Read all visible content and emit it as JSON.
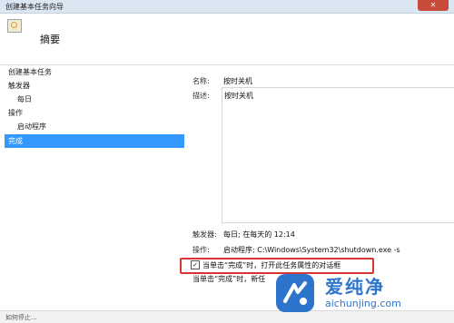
{
  "window": {
    "title": "创建基本任务向导",
    "close_glyph": "✕"
  },
  "header": {
    "page_title": "摘要"
  },
  "sidebar": {
    "items": [
      {
        "label": "创建基本任务"
      },
      {
        "label": "触发器"
      },
      {
        "label": "每日"
      },
      {
        "label": "操作"
      },
      {
        "label": "启动程序"
      },
      {
        "label": "完成"
      }
    ]
  },
  "summary": {
    "name_label": "名称:",
    "name_value": "按时关机",
    "desc_label": "描述:",
    "desc_value": "按时关机",
    "trigger_label": "触发器:",
    "trigger_value": "每日; 在每天的 12:14",
    "action_label": "操作:",
    "action_value": "启动程序; C:\\Windows\\System32\\shutdown.exe -s"
  },
  "options": {
    "open_properties_checked": true,
    "open_properties_label": "当单击“完成”时，打开此任务属性的对话框",
    "hint_text": "当单击“完成”时，新任"
  },
  "status_strip": {
    "text": "如何停止..."
  },
  "watermark": {
    "cn": "爱纯净",
    "url": "aichunjing.com"
  },
  "colors": {
    "selection": "#3399ff",
    "highlight_border": "#d83535",
    "watermark": "#2d75cc"
  }
}
